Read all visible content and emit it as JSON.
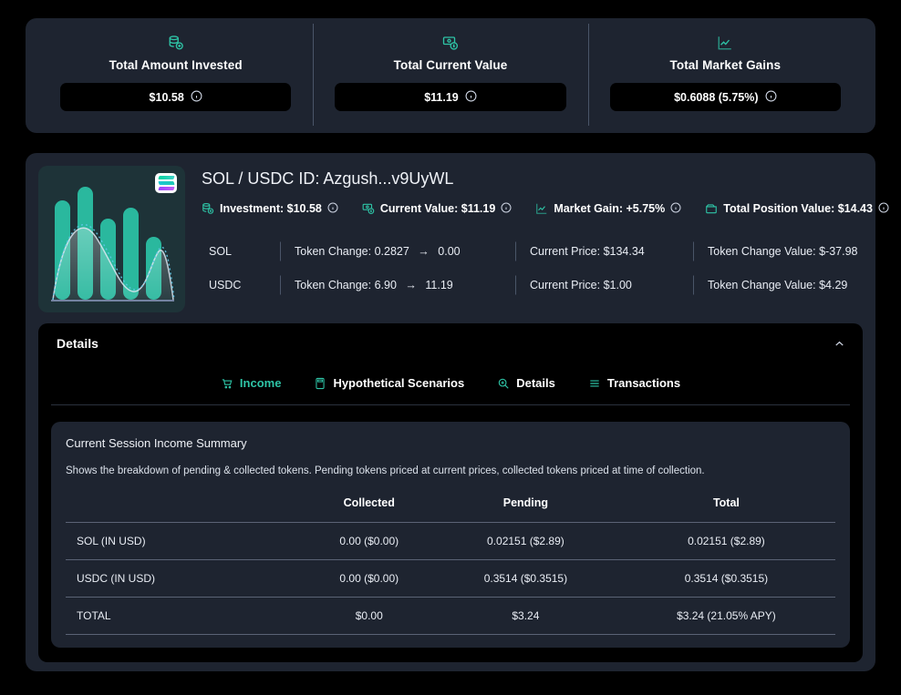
{
  "summary": {
    "cards": [
      {
        "icon": "database-plus-icon",
        "title": "Total Amount Invested",
        "value": "$10.58",
        "info": "info-icon"
      },
      {
        "icon": "money-value-icon",
        "title": "Total Current Value",
        "value": "$11.19",
        "info": "info-icon"
      },
      {
        "icon": "line-chart-icon",
        "title": "Total Market Gains",
        "value": "$0.6088 (5.75%)",
        "info": "info-icon"
      }
    ]
  },
  "position": {
    "thumbnail_alt": "position-chart-thumbnail",
    "badge": "solana-logo",
    "title": "SOL / USDC ID: Azgush...v9UyWL",
    "metrics": [
      {
        "icon": "database-icon",
        "label": "Investment: $10.58"
      },
      {
        "icon": "money-icon",
        "label": "Current Value: $11.19"
      },
      {
        "icon": "chart-icon",
        "label": "Market Gain: +5.75%"
      },
      {
        "icon": "wallet-icon",
        "label": "Total Position Value: $14.43"
      }
    ],
    "tokens": [
      {
        "symbol": "SOL",
        "change_label": "Token Change:",
        "change_from": "0.2827",
        "change_arrow": "→",
        "change_to": "0.00",
        "price": "Current Price: $134.34",
        "change_value": "Token Change Value: $-37.98"
      },
      {
        "symbol": "USDC",
        "change_label": "Token Change:",
        "change_from": "6.90",
        "change_arrow": "→",
        "change_to": "11.19",
        "price": "Current Price: $1.00",
        "change_value": "Token Change Value: $4.29"
      }
    ]
  },
  "details": {
    "title": "Details",
    "collapse_icon": "chevron-up-icon",
    "tabs": [
      {
        "icon": "cart-icon",
        "label": "Income",
        "active": true
      },
      {
        "icon": "calculator-icon",
        "label": "Hypothetical Scenarios",
        "active": false
      },
      {
        "icon": "magnifier-icon",
        "label": "Details",
        "active": false
      },
      {
        "icon": "list-icon",
        "label": "Transactions",
        "active": false
      }
    ]
  },
  "income": {
    "title": "Current Session Income Summary",
    "subtitle": "Shows the breakdown of pending & collected tokens. Pending tokens priced at current prices, collected tokens priced at time of collection.",
    "columns": [
      "",
      "Collected",
      "Pending",
      "Total"
    ],
    "rows": [
      {
        "label": "SOL (IN USD)",
        "collected": "0.00 ($0.00)",
        "pending": "0.02151 ($2.89)",
        "total": "0.02151 ($2.89)"
      },
      {
        "label": "USDC (IN USD)",
        "collected": "0.00 ($0.00)",
        "pending": "0.3514 ($0.3515)",
        "total": "0.3514 ($0.3515)"
      },
      {
        "label": "TOTAL",
        "collected": "$0.00",
        "pending": "$3.24",
        "total": "$3.24 (21.05% APY)"
      }
    ]
  },
  "colors": {
    "page_bg": "#000000",
    "card_bg": "#1e2430",
    "accent": "#2ec4a6",
    "divider": "#4a5568",
    "text": "#ffffff"
  }
}
